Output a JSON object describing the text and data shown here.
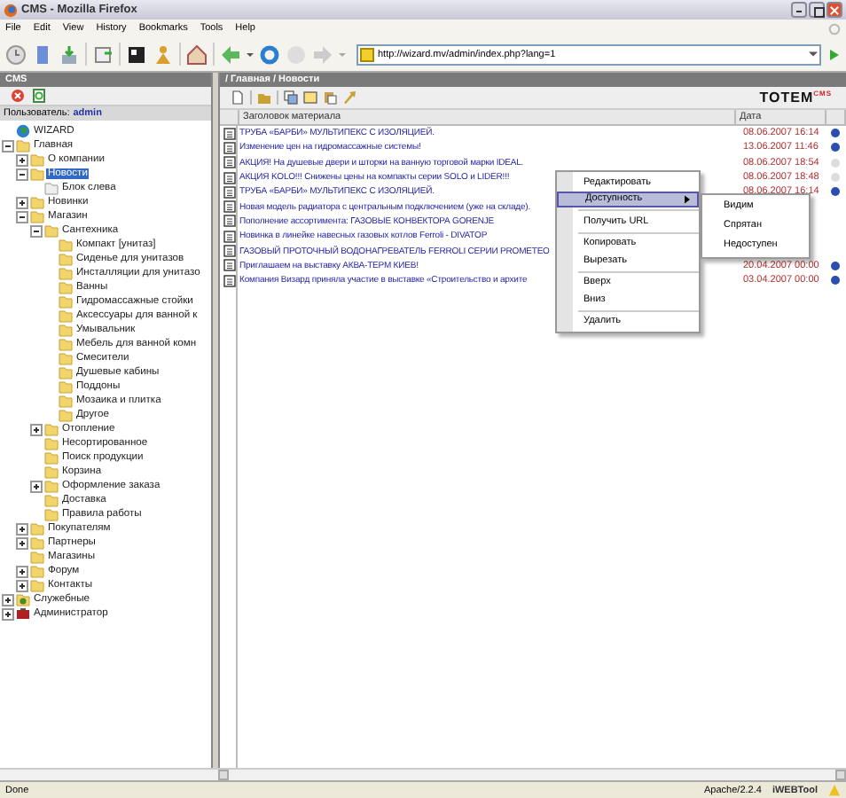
{
  "window": {
    "title": "CMS - Mozilla Firefox"
  },
  "menu": [
    "File",
    "Edit",
    "View",
    "History",
    "Bookmarks",
    "Tools",
    "Help"
  ],
  "address": {
    "value": "http://wizard.mv/admin/index.php?lang=1"
  },
  "left_panel": {
    "title": "CMS",
    "user_label": "Пользователь:",
    "user": "admin"
  },
  "tree": [
    {
      "label": "WIZARD",
      "kind": "globe",
      "selected": false
    },
    {
      "label": "Главная",
      "kind": "folder",
      "selected": false,
      "expanded": true,
      "children": [
        {
          "label": "О компании",
          "kind": "folder",
          "selected": false,
          "expanded": false
        },
        {
          "label": "Новости",
          "kind": "folder",
          "selected": true,
          "expanded": true,
          "children": [
            {
              "label": "Блок слева",
              "kind": "page",
              "selected": false
            }
          ]
        },
        {
          "label": "Новинки",
          "kind": "folder",
          "selected": false,
          "expanded": false
        },
        {
          "label": "Магазин",
          "kind": "folder",
          "selected": false,
          "expanded": true,
          "children": [
            {
              "label": "Сантехника",
              "kind": "folder",
              "selected": false,
              "expanded": true,
              "children": [
                {
                  "label": "Компакт [унитаз]",
                  "kind": "folder",
                  "selected": false
                },
                {
                  "label": "Сиденье для унитазов",
                  "kind": "folder",
                  "selected": false
                },
                {
                  "label": "Инсталляции для унитазо",
                  "kind": "folder",
                  "selected": false
                },
                {
                  "label": "Ванны",
                  "kind": "folder",
                  "selected": false
                },
                {
                  "label": "Гидромассажные стойки",
                  "kind": "folder",
                  "selected": false
                },
                {
                  "label": "Аксессуары для ванной к",
                  "kind": "folder",
                  "selected": false
                },
                {
                  "label": "Умывальник",
                  "kind": "folder",
                  "selected": false
                },
                {
                  "label": "Мебель для ванной комн",
                  "kind": "folder",
                  "selected": false
                },
                {
                  "label": "Смесители",
                  "kind": "folder",
                  "selected": false
                },
                {
                  "label": "Душевые кабины",
                  "kind": "folder",
                  "selected": false
                },
                {
                  "label": "Поддоны",
                  "kind": "folder",
                  "selected": false
                },
                {
                  "label": "Мозаика и плитка",
                  "kind": "folder",
                  "selected": false
                },
                {
                  "label": "Другое",
                  "kind": "folder",
                  "selected": false
                }
              ]
            },
            {
              "label": "Отопление",
              "kind": "folder",
              "selected": false,
              "expanded": false
            },
            {
              "label": "Несортированное",
              "kind": "folder",
              "selected": false
            },
            {
              "label": "Поиск продукции",
              "kind": "folder",
              "selected": false
            },
            {
              "label": "Корзина",
              "kind": "folder",
              "selected": false
            },
            {
              "label": "Оформление заказа",
              "kind": "folder",
              "selected": false,
              "expanded": false
            },
            {
              "label": "Доставка",
              "kind": "folder",
              "selected": false
            },
            {
              "label": "Правила работы",
              "kind": "folder",
              "selected": false
            }
          ]
        },
        {
          "label": "Покупателям",
          "kind": "folder",
          "selected": false,
          "expanded": false
        },
        {
          "label": "Партнеры",
          "kind": "folder",
          "selected": false,
          "expanded": false
        },
        {
          "label": "Магазины",
          "kind": "folder",
          "selected": false
        },
        {
          "label": "Форум",
          "kind": "folder",
          "selected": false,
          "expanded": false
        },
        {
          "label": "Контакты",
          "kind": "folder",
          "selected": false,
          "expanded": false
        }
      ]
    },
    {
      "label": "Служебные",
      "kind": "service",
      "selected": false,
      "expanded": false
    },
    {
      "label": "Администратор",
      "kind": "admin",
      "selected": false,
      "expanded": false
    }
  ],
  "right_panel": {
    "breadcrumb": "/ Главная / Новости",
    "logo": "TOTEM",
    "logo_sup": "CMS"
  },
  "table": {
    "columns": [
      "Заголовок материала",
      "Дата"
    ],
    "rows": [
      {
        "title": "ТРУБА «БАРБИ» МУЛЬТИПЕКС С ИЗОЛЯЦИЕЙ.",
        "date": "08.06.2007 16:14",
        "visible": true
      },
      {
        "title": "Изменение цен на гидромассажные системы!",
        "date": "13.06.2007 11:46",
        "visible": true
      },
      {
        "title": "АКЦИЯ! На душевые двери и шторки на ванную торговой марки IDEAL.",
        "date": "08.06.2007 18:54",
        "visible": false
      },
      {
        "title": "АКЦИЯ KOLO!!! Снижены цены на компакты серии SOLO и LIDER!!!",
        "date": "08.06.2007 18:48",
        "visible": false
      },
      {
        "title": "ТРУБА «БАРБИ» МУЛЬТИПЕКС С ИЗОЛЯЦИЕЙ.",
        "date": "08.06.2007 16:14",
        "visible": true
      },
      {
        "title": "Новая модель радиатора с центральным подключением (уже на складе)."
      },
      {
        "title": "Пополнение ассортимента: ГАЗОВЫЕ КОНВЕКТОРА GORENJE"
      },
      {
        "title": "Новинка в линейке навесных газовых котлов Ferroli - DIVATOP"
      },
      {
        "title": "ГАЗОВЫЙ ПРОТОЧНЫЙ ВОДОНАГРЕВАТЕЛЬ FERROLI СЕРИИ PROMETEO"
      },
      {
        "title": "Приглашаем на выставку АКВА-ТЕРМ КИЕВ!",
        "date": "20.04.2007 00:00",
        "visible": true
      },
      {
        "title": "Компания Визард приняла участие в выставке «Строительство и архите",
        "date": "03.04.2007 00:00",
        "visible": true
      }
    ]
  },
  "context_menu": [
    {
      "label": "Редактировать",
      "selected": false
    },
    {
      "label": "Доступность",
      "selected": true,
      "submenu": true
    },
    {
      "kind": "separator"
    },
    {
      "label": "Получить URL",
      "selected": false
    },
    {
      "kind": "separator"
    },
    {
      "label": "Копировать",
      "selected": false
    },
    {
      "label": "Вырезать",
      "selected": false
    },
    {
      "kind": "separator"
    },
    {
      "label": "Вверх",
      "selected": false
    },
    {
      "label": "Вниз",
      "selected": false
    },
    {
      "kind": "separator"
    },
    {
      "label": "Удалить",
      "selected": false
    }
  ],
  "submenu": [
    "Видим",
    "Спрятан",
    "Недоступен"
  ],
  "status_bar": {
    "text": "Done",
    "server": "Apache/2.2.4",
    "tool": "iWEBTool"
  }
}
